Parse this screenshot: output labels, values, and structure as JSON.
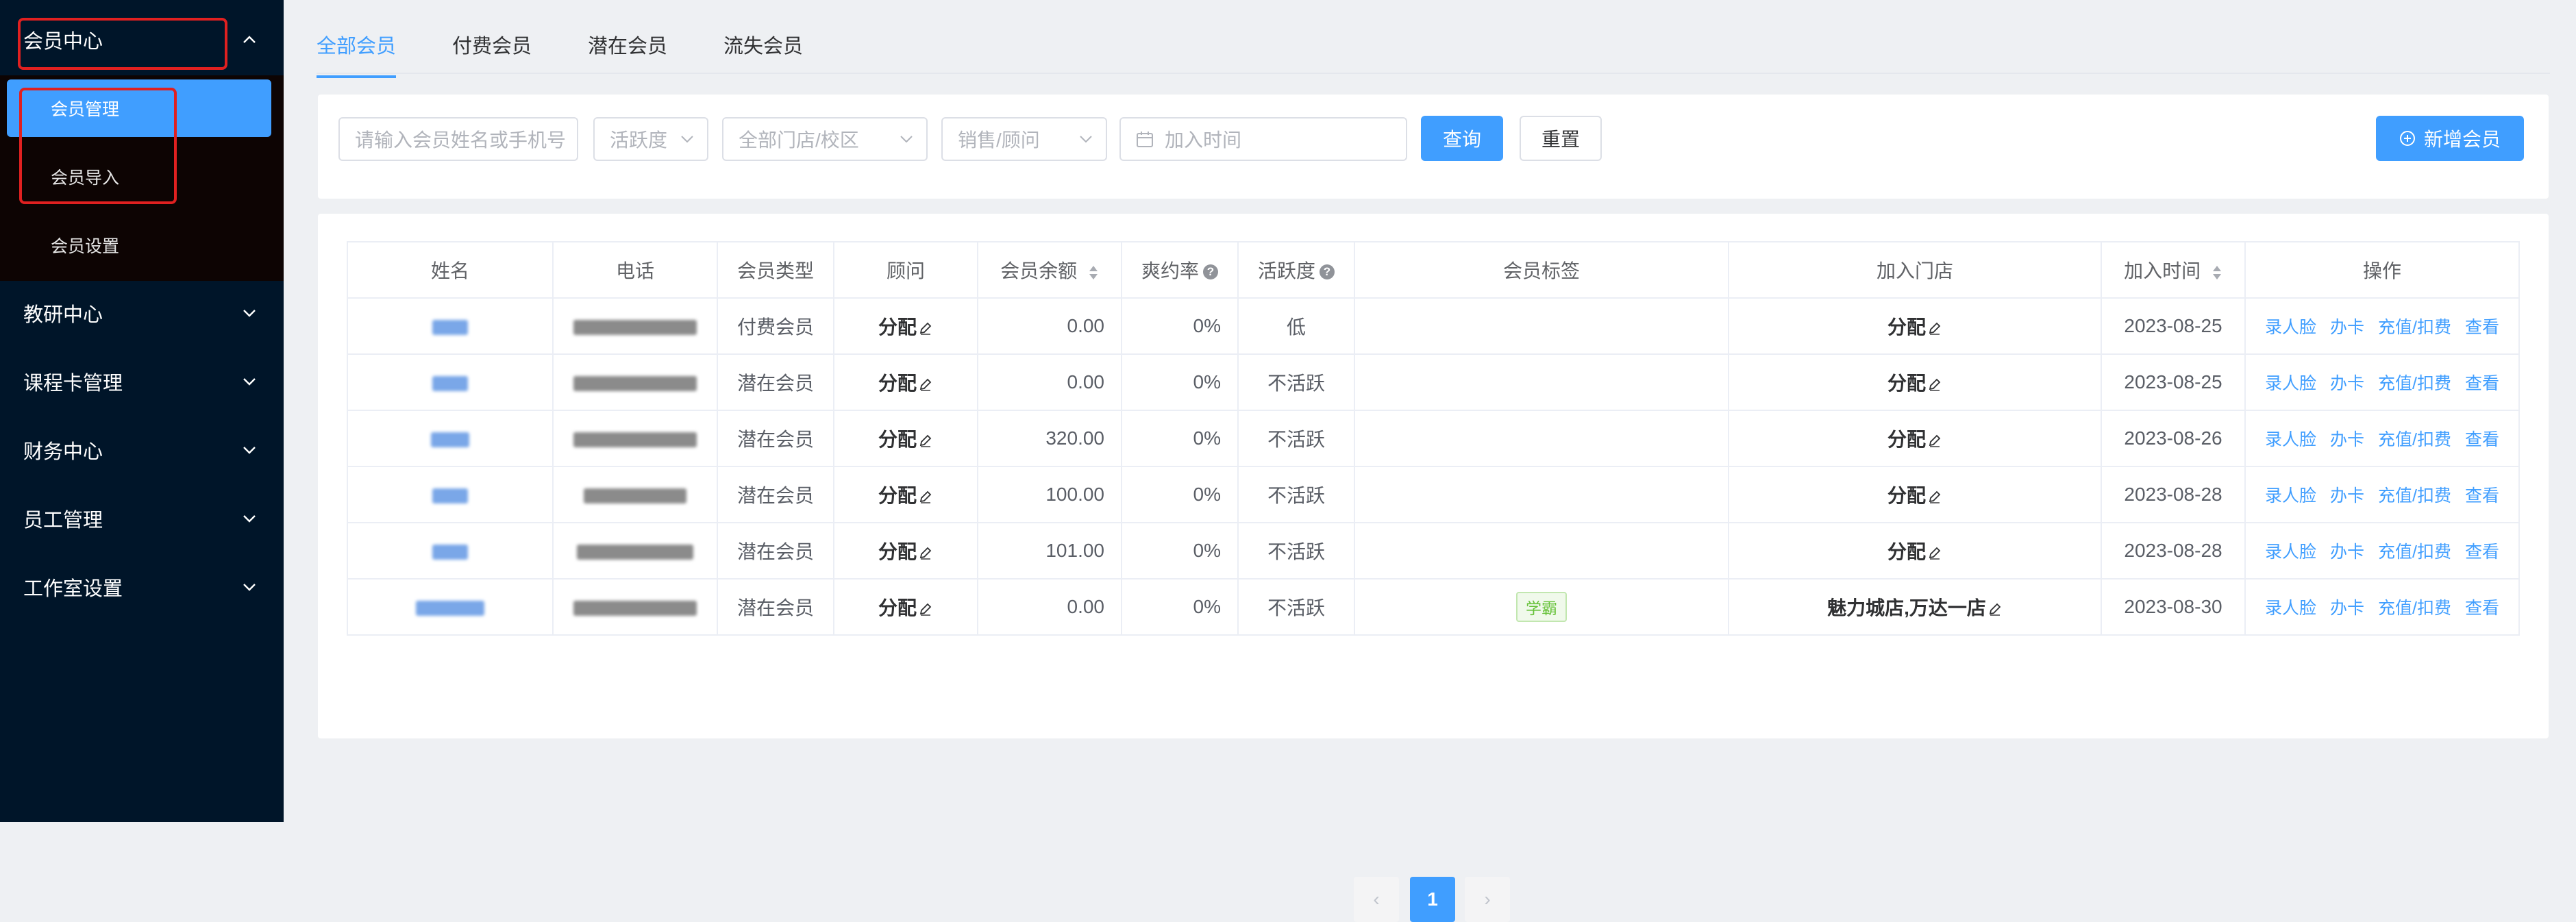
{
  "sidebar": {
    "member_center": "会员中心",
    "sub_items": [
      "会员管理",
      "会员导入",
      "会员设置"
    ],
    "menus": [
      "教研中心",
      "课程卡管理",
      "财务中心",
      "员工管理",
      "工作室设置"
    ]
  },
  "tabs": [
    "全部会员",
    "付费会员",
    "潜在会员",
    "流失会员"
  ],
  "filters": {
    "name_placeholder": "请输入会员姓名或手机号",
    "activity": "活跃度",
    "store": "全部门店/校区",
    "consultant": "销售/顾问",
    "join_time": "加入时间",
    "query": "查询",
    "reset": "重置",
    "add_member": "新增会员"
  },
  "table": {
    "headers": [
      "姓名",
      "电话",
      "会员类型",
      "顾问",
      "会员余额",
      "爽约率",
      "活跃度",
      "会员标签",
      "加入门店",
      "加入时间",
      "操作"
    ],
    "rows": [
      {
        "type": "付费会员",
        "consultant": "分配",
        "balance": "0.00",
        "rate": "0%",
        "activity": "低",
        "tag": "",
        "store": "分配",
        "date": "2023-08-25"
      },
      {
        "type": "潜在会员",
        "consultant": "分配",
        "balance": "0.00",
        "rate": "0%",
        "activity": "不活跃",
        "tag": "",
        "store": "分配",
        "date": "2023-08-25"
      },
      {
        "type": "潜在会员",
        "consultant": "分配",
        "balance": "320.00",
        "rate": "0%",
        "activity": "不活跃",
        "tag": "",
        "store": "分配",
        "date": "2023-08-26"
      },
      {
        "type": "潜在会员",
        "consultant": "分配",
        "balance": "100.00",
        "rate": "0%",
        "activity": "不活跃",
        "tag": "",
        "store": "分配",
        "date": "2023-08-28"
      },
      {
        "type": "潜在会员",
        "consultant": "分配",
        "balance": "101.00",
        "rate": "0%",
        "activity": "不活跃",
        "tag": "",
        "store": "分配",
        "date": "2023-08-28"
      },
      {
        "type": "潜在会员",
        "consultant": "分配",
        "balance": "0.00",
        "rate": "0%",
        "activity": "不活跃",
        "tag": "学霸",
        "store": "魅力城店,万达一店",
        "date": "2023-08-30"
      }
    ],
    "actions": [
      "录人脸",
      "办卡",
      "充值/扣费",
      "查看"
    ]
  },
  "pagination": {
    "prev": "‹",
    "current": "1",
    "next": "›"
  },
  "colors": {
    "primary": "#409eff",
    "sidebar_bg": "#001529",
    "highlight": "#e02020"
  }
}
